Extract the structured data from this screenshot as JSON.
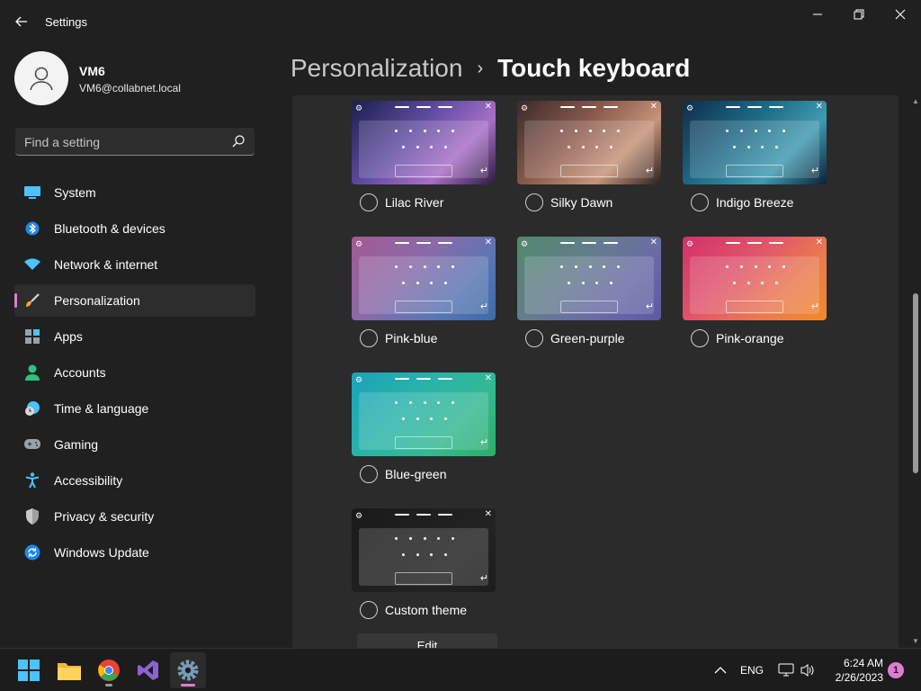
{
  "window": {
    "title": "Settings"
  },
  "user": {
    "name": "VM6",
    "email": "VM6@collabnet.local"
  },
  "search": {
    "placeholder": "Find a setting"
  },
  "nav": {
    "items": [
      {
        "label": "System",
        "icon": "system-icon",
        "active": false
      },
      {
        "label": "Bluetooth & devices",
        "icon": "bluetooth-icon",
        "active": false
      },
      {
        "label": "Network & internet",
        "icon": "wifi-icon",
        "active": false
      },
      {
        "label": "Personalization",
        "icon": "brush-icon",
        "active": true
      },
      {
        "label": "Apps",
        "icon": "apps-icon",
        "active": false
      },
      {
        "label": "Accounts",
        "icon": "person-icon",
        "active": false
      },
      {
        "label": "Time & language",
        "icon": "clock-globe-icon",
        "active": false
      },
      {
        "label": "Gaming",
        "icon": "gamepad-icon",
        "active": false
      },
      {
        "label": "Accessibility",
        "icon": "accessibility-icon",
        "active": false
      },
      {
        "label": "Privacy & security",
        "icon": "shield-icon",
        "active": false
      },
      {
        "label": "Windows Update",
        "icon": "update-icon",
        "active": false
      }
    ]
  },
  "breadcrumb": {
    "parent": "Personalization",
    "separator": "›",
    "current": "Touch keyboard"
  },
  "themes": [
    {
      "label": "Lilac River",
      "colors": [
        "#1b1f4d",
        "#5f4ba0",
        "#a86fc7",
        "#2c1a3d"
      ],
      "selected": false
    },
    {
      "label": "Silky Dawn",
      "colors": [
        "#3b2a2a",
        "#8b5a4c",
        "#c69479",
        "#2d1f20"
      ],
      "selected": false
    },
    {
      "label": "Indigo Breeze",
      "colors": [
        "#0f2d4a",
        "#1e6a86",
        "#3f9bb1",
        "#0c1f3a"
      ],
      "selected": false
    },
    {
      "label": "Pink-blue",
      "colors": [
        "#a35a92",
        "#8a6aa8",
        "#5b76b3",
        "#3d6aa8"
      ],
      "selected": false
    },
    {
      "label": "Green-purple",
      "colors": [
        "#4f8a6a",
        "#657c8e",
        "#6a6aa6",
        "#5b5aa3"
      ],
      "selected": false
    },
    {
      "label": "Pink-orange",
      "colors": [
        "#d2306a",
        "#e0566a",
        "#ea7a50",
        "#f08a2a"
      ],
      "selected": false
    },
    {
      "label": "Blue-green",
      "colors": [
        "#1aa3b8",
        "#2ab3aa",
        "#34b991",
        "#2cae6a"
      ],
      "selected": false
    },
    {
      "label": "Custom theme",
      "colors": [
        "#1a1a1a",
        "#1f1f1f",
        "#232323",
        "#1c1c1c"
      ],
      "selected": false
    }
  ],
  "edit_button": {
    "label": "Edit"
  },
  "taskbar": {
    "apps": [
      {
        "name": "start-button",
        "icon": "windows-logo-icon"
      },
      {
        "name": "file-explorer",
        "icon": "folder-icon"
      },
      {
        "name": "chrome",
        "icon": "chrome-icon"
      },
      {
        "name": "visual-studio",
        "icon": "visual-studio-icon"
      },
      {
        "name": "settings",
        "icon": "gear-icon"
      }
    ],
    "language": "ENG",
    "time": "6:24 AM",
    "date": "2/26/2023",
    "notifications": "1"
  },
  "colors": {
    "accent": "#e07bd6",
    "window_bg": "#202020",
    "content_bg": "#2b2b2b"
  }
}
